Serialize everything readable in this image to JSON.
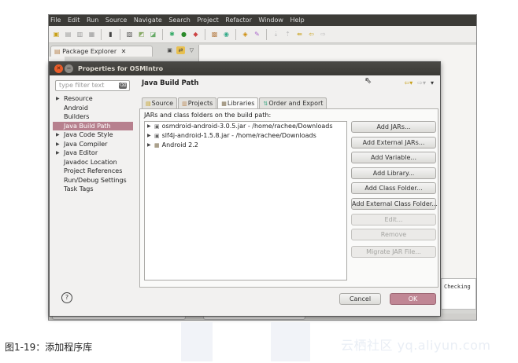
{
  "menubar": [
    "File",
    "Edit",
    "Run",
    "Source",
    "Navigate",
    "Search",
    "Project",
    "Refactor",
    "Window",
    "Help"
  ],
  "view": {
    "package_explorer_tab": "Package Explorer"
  },
  "console_text": "Checking",
  "dialog": {
    "title": "Properties for OSMIntro",
    "filter_placeholder": "type filter text",
    "nav": [
      {
        "label": "Resource",
        "expandable": true
      },
      {
        "label": "Android",
        "expandable": false
      },
      {
        "label": "Builders",
        "expandable": false
      },
      {
        "label": "Java Build Path",
        "expandable": false,
        "selected": true
      },
      {
        "label": "Java Code Style",
        "expandable": true
      },
      {
        "label": "Java Compiler",
        "expandable": true
      },
      {
        "label": "Java Editor",
        "expandable": true
      },
      {
        "label": "Javadoc Location",
        "expandable": false
      },
      {
        "label": "Project References",
        "expandable": false
      },
      {
        "label": "Run/Debug Settings",
        "expandable": false
      },
      {
        "label": "Task Tags",
        "expandable": false
      }
    ],
    "pane_title": "Java Build Path",
    "tabs": [
      "Source",
      "Projects",
      "Libraries",
      "Order and Export"
    ],
    "active_tab": "Libraries",
    "jar_label": "JARs and class folders on the build path:",
    "libraries": [
      "osmdroid-android-3.0.5.jar - /home/rachee/Downloads",
      "slf4j-android-1.5.8.jar - /home/rachee/Downloads",
      "Android 2.2"
    ],
    "buttons": {
      "add_jars": "Add JARs...",
      "add_external_jars": "Add External JARs...",
      "add_variable": "Add Variable...",
      "add_library": "Add Library...",
      "add_class_folder": "Add Class Folder...",
      "add_external_class_folder": "Add External Class Folder...",
      "edit": "Edit...",
      "remove": "Remove",
      "migrate_jar": "Migrate JAR File..."
    },
    "cancel": "Cancel",
    "ok": "OK",
    "help": "?"
  },
  "caption": "图1-19：添加程序库",
  "watermark": "云栖社区 yq.aliyun.com",
  "colors": {
    "selection": "#b7808e",
    "ok_button": "#c08694",
    "title_bar": "#3c3b37"
  }
}
